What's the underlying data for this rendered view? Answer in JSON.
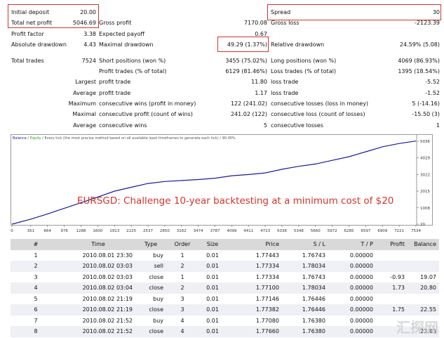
{
  "report": {
    "rows": [
      [
        {
          "label": "Initial deposit",
          "value": "20.00"
        },
        {
          "label": "",
          "value": ""
        },
        {
          "label": "Spread",
          "value": "30"
        }
      ],
      [
        {
          "label": "Total net profit",
          "value": "5046.69"
        },
        {
          "label": "Gross profit",
          "value": "7170.08"
        },
        {
          "label": "Gross loss",
          "value": "-2123.39"
        }
      ],
      [
        {
          "label": "Profit factor",
          "value": "3.38"
        },
        {
          "label": "Expected payoff",
          "value": "0.67"
        },
        {
          "label": "",
          "value": ""
        }
      ],
      [
        {
          "label": "Absolute drawdown",
          "value": "4.43"
        },
        {
          "label": "Maximal drawdown",
          "value": "49.29 (1.37%)"
        },
        {
          "label": "Relative drawdown",
          "value": "24.59% (5.08)"
        }
      ],
      [
        {
          "label": "Total trades",
          "value": "7524"
        },
        {
          "label": "Short positions (won %)",
          "value": "3455 (75.02%)"
        },
        {
          "label": "Long positions (won %)",
          "value": "4069 (86.93%)"
        }
      ],
      [
        {
          "label": "",
          "value": ""
        },
        {
          "label": "Profit trades (% of total)",
          "value": "6129 (81.46%)"
        },
        {
          "label": "Loss trades (% of total)",
          "value": "1395 (18.54%)"
        }
      ],
      [
        {
          "label": "Largest",
          "value": ""
        },
        {
          "label": "profit trade",
          "value": "11.80"
        },
        {
          "label": "loss trade",
          "value": "-5.52"
        }
      ],
      [
        {
          "label": "Average",
          "value": ""
        },
        {
          "label": "profit trade",
          "value": "1.17"
        },
        {
          "label": "loss trade",
          "value": "-1.52"
        }
      ],
      [
        {
          "label": "Maximum",
          "value": ""
        },
        {
          "label": "consecutive wins (profit in money)",
          "value": "122 (241.02)"
        },
        {
          "label": "consecutive losses (loss in money)",
          "value": "5 (-14.16)"
        }
      ],
      [
        {
          "label": "Maximal",
          "value": ""
        },
        {
          "label": "consecutive profit (count of wins)",
          "value": "241.02 (122)"
        },
        {
          "label": "consecutive loss (count of losses)",
          "value": "-15.50 (3)"
        }
      ],
      [
        {
          "label": "Average",
          "value": ""
        },
        {
          "label": "consecutive wins",
          "value": "5"
        },
        {
          "label": "consecutive losses",
          "value": "1"
        }
      ]
    ]
  },
  "chart_data": {
    "type": "line",
    "header_text": "Balance / Equity / Every tick (the most precise method based on all available least timeframes to generate each tick) / 90.00%",
    "header_parts": {
      "balance": "Balance",
      "equity": "Equity",
      "rest": "/ Every tick (the most precise method based on all available least timeframes to generate each tick) / 90.00%"
    },
    "annotation": "EURSGD: Challenge 10-year backtesting at a minimum cost of $20",
    "x_ticks": [
      "0",
      "351",
      "664",
      "976",
      "1288",
      "1600",
      "1913",
      "2225",
      "2537",
      "2850",
      "3162",
      "3474",
      "3787",
      "4099",
      "4411",
      "4723",
      "5036",
      "5348",
      "5660",
      "5972",
      "6285",
      "6597",
      "6909",
      "7221",
      "7534"
    ],
    "y_ticks": [
      "5036",
      "4029",
      "3022",
      "2015",
      "1008",
      "20"
    ],
    "ylim": [
      20,
      5036
    ],
    "xlim": [
      0,
      7534
    ],
    "series": [
      {
        "name": "Balance",
        "color": "#1a1aa0",
        "x": [
          0,
          351,
          664,
          976,
          1288,
          1600,
          1913,
          2225,
          2537,
          2850,
          3162,
          3474,
          3787,
          4099,
          4411,
          4723,
          5036,
          5348,
          5660,
          5972,
          6285,
          6597,
          6909,
          7221,
          7534
        ],
        "y": [
          20,
          320,
          640,
          980,
          1320,
          1660,
          2020,
          2250,
          2480,
          2600,
          2660,
          2720,
          2800,
          2950,
          3020,
          3120,
          3340,
          3520,
          3660,
          3880,
          4100,
          4400,
          4700,
          4900,
          5050
        ]
      }
    ],
    "grid": false,
    "legend": "top-left",
    "line_color": "#1a1aa0",
    "accent_color": "#d2342c"
  },
  "trades": {
    "headers": [
      "#",
      "Time",
      "Type",
      "Order",
      "Size",
      "Price",
      "S / L",
      "T / P",
      "Profit",
      "Balance"
    ],
    "rows": [
      [
        "1",
        "2010.08.01 23:30",
        "buy",
        "1",
        "0.01",
        "1.77443",
        "1.76743",
        "0.00000",
        "",
        ""
      ],
      [
        "2",
        "2010.08.02 03:03",
        "sell",
        "2",
        "0.01",
        "1.77334",
        "1.78034",
        "0.00000",
        "",
        ""
      ],
      [
        "3",
        "2010.08.02 03:03",
        "close",
        "1",
        "0.01",
        "1.77334",
        "1.76743",
        "0.00000",
        "-0.93",
        "19.07"
      ],
      [
        "4",
        "2010.08.02 03:04",
        "close",
        "2",
        "0.01",
        "1.77100",
        "1.78034",
        "0.00000",
        "1.73",
        "20.80"
      ],
      [
        "5",
        "2010.08.02 21:19",
        "buy",
        "3",
        "0.01",
        "1.77146",
        "1.76446",
        "0.00000",
        "",
        ""
      ],
      [
        "6",
        "2010.08.02 21:19",
        "close",
        "3",
        "0.01",
        "1.77382",
        "1.76446",
        "0.00000",
        "1.75",
        "22.55"
      ],
      [
        "7",
        "2010.08.02 21:52",
        "buy",
        "4",
        "0.01",
        "1.77080",
        "1.76380",
        "0.00000",
        "",
        ""
      ],
      [
        "8",
        "2010.08.02 21:52",
        "close",
        "4",
        "0.01",
        "1.77660",
        "1.76380",
        "0.00000",
        "",
        "23.83"
      ]
    ]
  },
  "watermark": "汇探网"
}
